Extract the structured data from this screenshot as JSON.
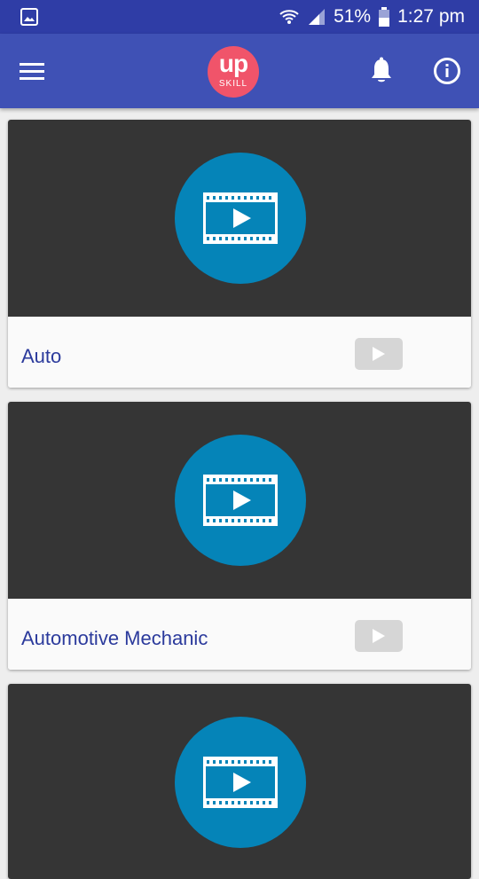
{
  "status_bar": {
    "battery": "51%",
    "time": "1:27 pm",
    "icons": [
      "gallery-icon",
      "wifi-icon",
      "signal-icon",
      "battery-icon"
    ]
  },
  "app_bar": {
    "logo_up": "up",
    "logo_skill": "SKILL",
    "icons": [
      "menu-icon",
      "bell-icon",
      "info-icon"
    ],
    "colors": {
      "bar": "#3f51b5",
      "status": "#2f3da6",
      "logo": "#f0546a"
    }
  },
  "videos": [
    {
      "title": "Auto",
      "icon": "video-file-icon",
      "action_icon": "play-icon"
    },
    {
      "title": "Automotive Mechanic",
      "icon": "video-file-icon",
      "action_icon": "play-icon"
    },
    {
      "title": "",
      "icon": "video-file-icon",
      "action_icon": "play-icon"
    }
  ],
  "colors": {
    "media_bg": "#353535",
    "video_circle": "#0584b8",
    "title_text": "#2b3a9c",
    "play_button": "#d6d6d6"
  }
}
